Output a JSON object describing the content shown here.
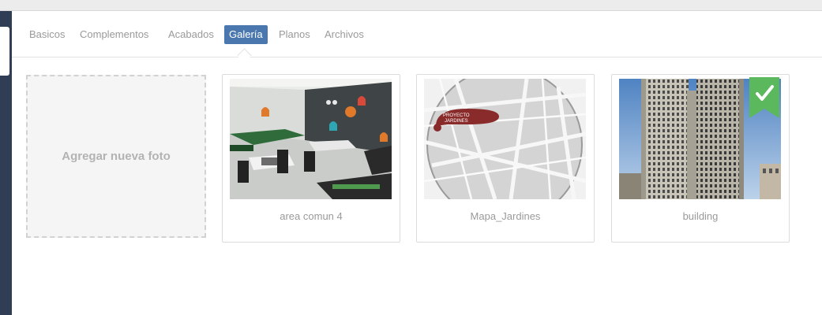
{
  "tabs": [
    {
      "label": "Basicos",
      "active": false
    },
    {
      "label": "Complementos",
      "active": false
    },
    {
      "label": "Acabados",
      "active": false
    },
    {
      "label": "Galería",
      "active": true
    },
    {
      "label": "Planos",
      "active": false
    },
    {
      "label": "Archivos",
      "active": false
    }
  ],
  "gallery": {
    "add_label": "Agregar nueva foto",
    "items": [
      {
        "caption": "area comun 4",
        "image": "game-room-photo"
      },
      {
        "caption": "Mapa_Jardines",
        "image": "street-map-photo"
      },
      {
        "caption": "building",
        "image": "building-photo",
        "selected": true,
        "badge_icon": "checkmark-icon"
      }
    ]
  },
  "map_label": {
    "line1": "PROYECTO",
    "line2": "JARDINES"
  },
  "colors": {
    "sidebar": "#2f3e55",
    "active_tab": "#4a78ae",
    "selected_badge": "#5cb85c"
  }
}
